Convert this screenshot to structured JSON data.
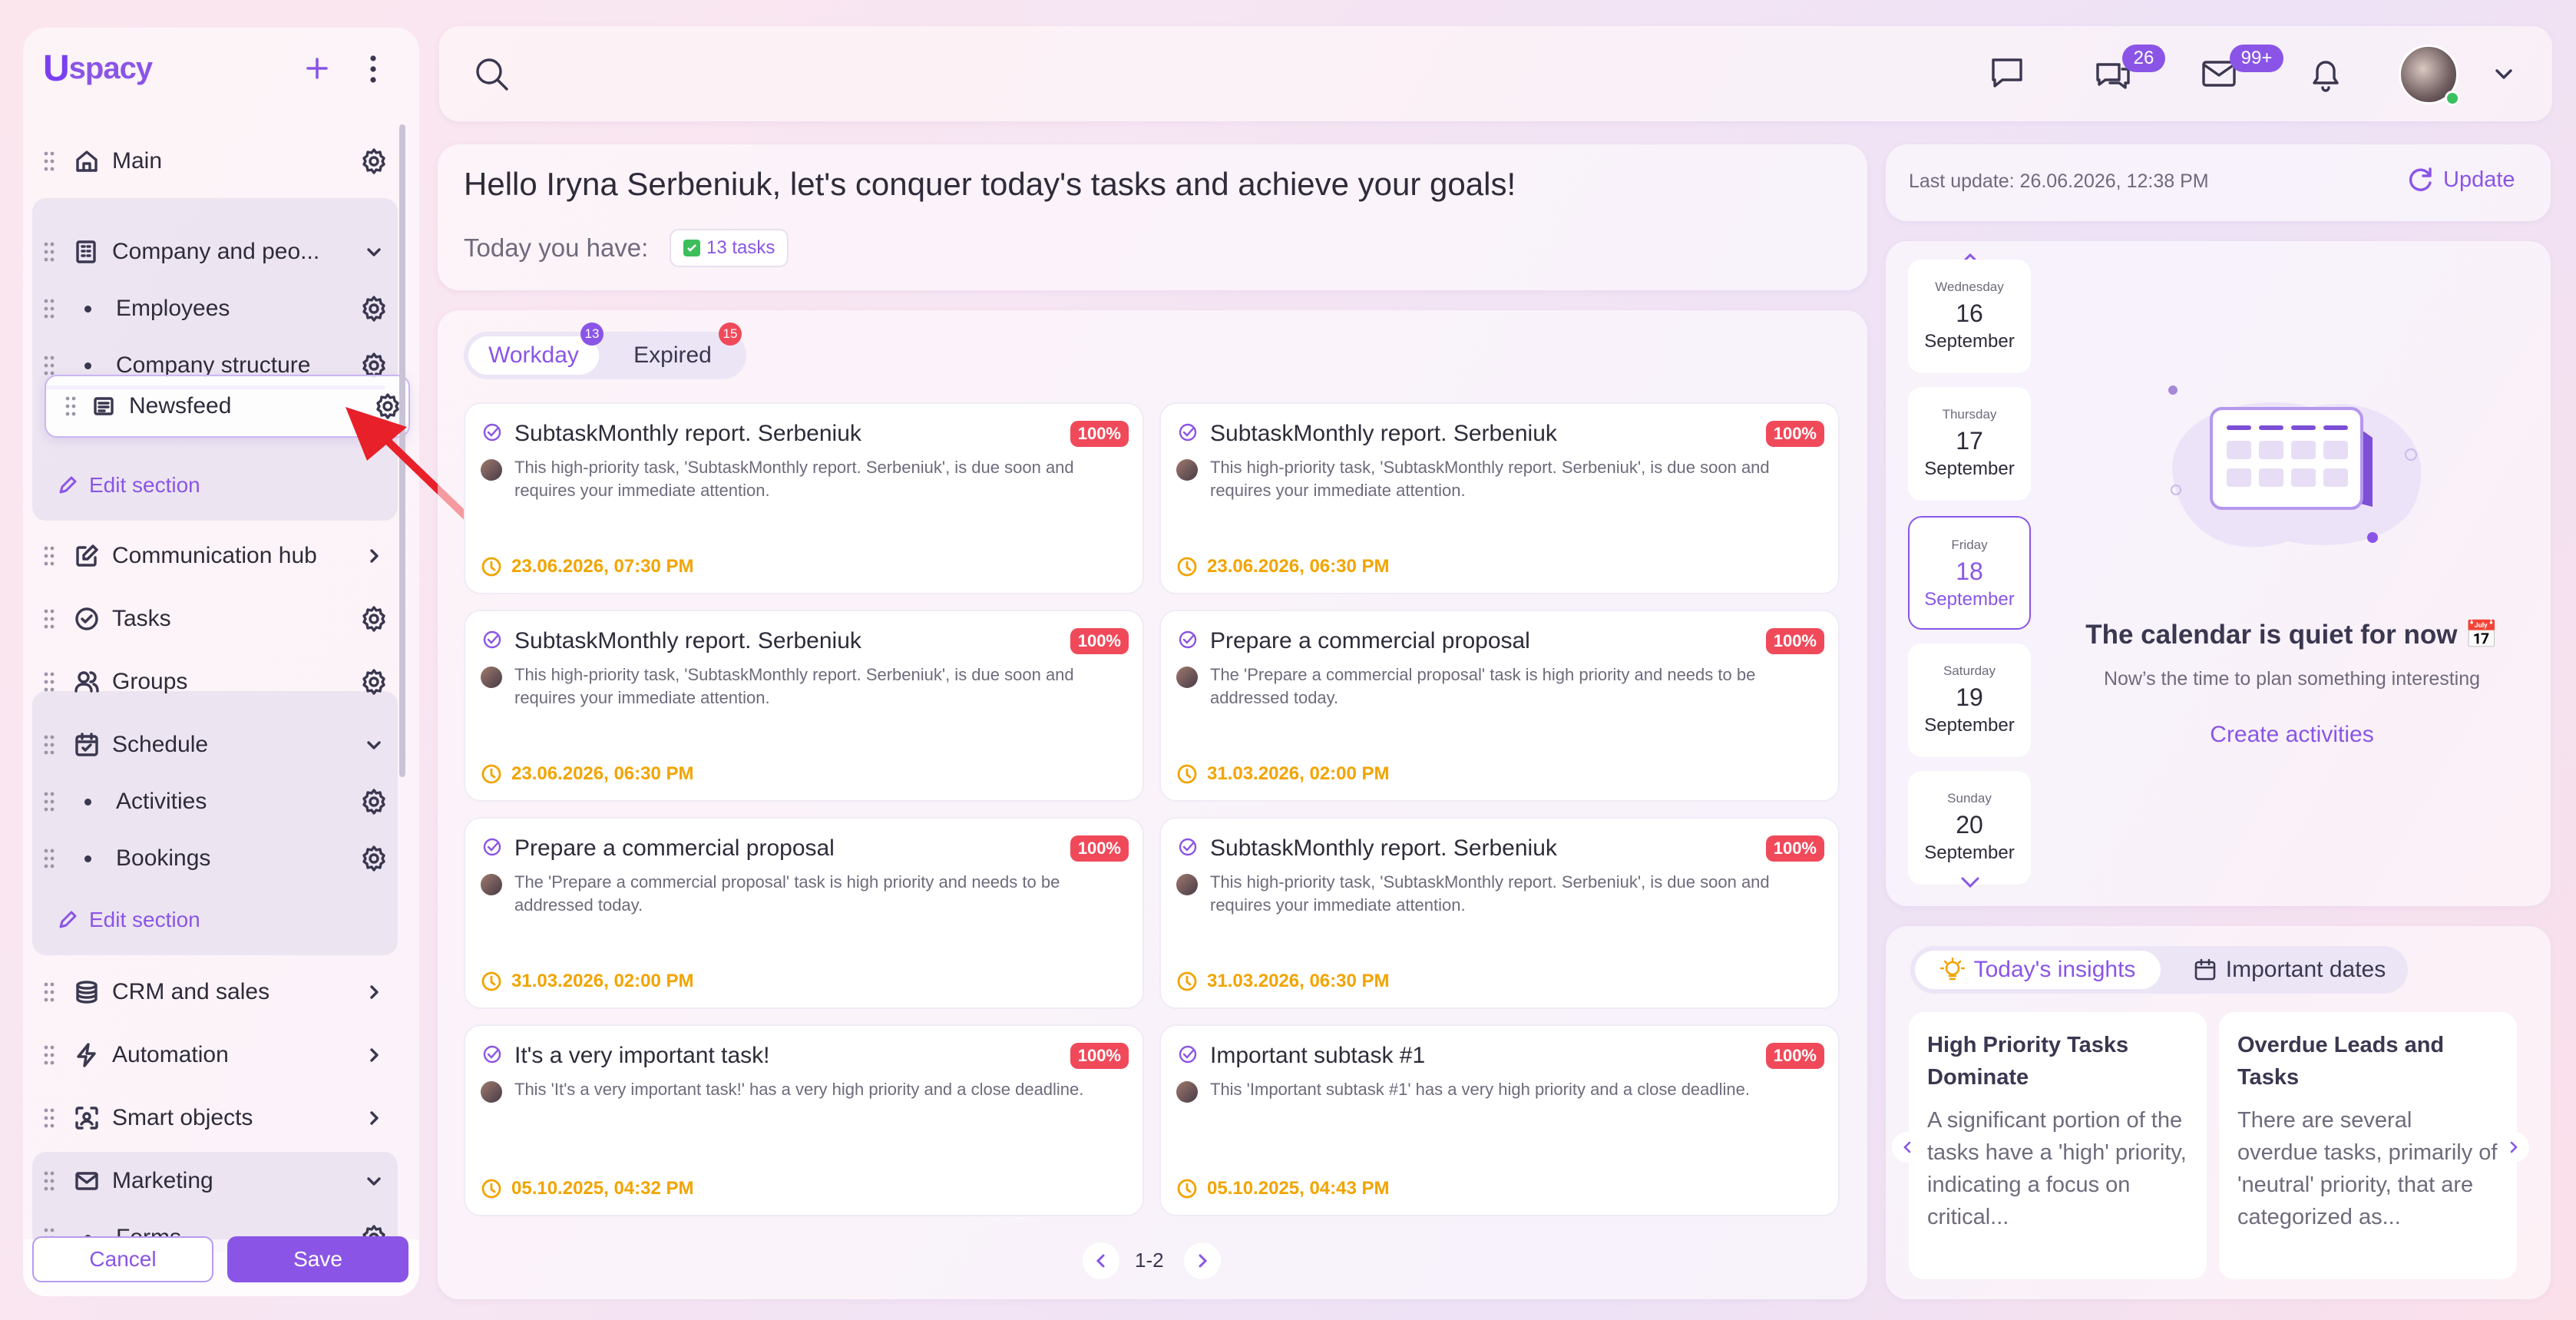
{
  "app": {
    "logo": "spacy",
    "logo_mark": "U"
  },
  "sidebar": {
    "items": [
      {
        "label": "Main"
      },
      {
        "label": "Company and peo..."
      },
      {
        "label": "Employees"
      },
      {
        "label": "Company structure"
      },
      {
        "label": "Newsfeed"
      },
      {
        "label": "Communication hub"
      },
      {
        "label": "Tasks"
      },
      {
        "label": "Groups"
      },
      {
        "label": "Schedule"
      },
      {
        "label": "Activities"
      },
      {
        "label": "Bookings"
      },
      {
        "label": "CRM and sales"
      },
      {
        "label": "Automation"
      },
      {
        "label": "Smart objects"
      },
      {
        "label": "Marketing"
      },
      {
        "label": "Forms"
      }
    ],
    "edit_section": "Edit section",
    "cancel": "Cancel",
    "save": "Save"
  },
  "header": {
    "chat_badge": "26",
    "mail_badge": "99+"
  },
  "greeting": {
    "text": "Hello Iryna Serbeniuk, let's conquer today's tasks and achieve your goals!",
    "today_label": "Today you have:",
    "tasks_chip": "13 tasks"
  },
  "tabs": [
    {
      "label": "Workday",
      "count": "13"
    },
    {
      "label": "Expired",
      "count": "15"
    }
  ],
  "tasks": [
    {
      "title": "SubtaskMonthly report. Serbeniuk",
      "badge": "100%",
      "desc": "This high-priority task, 'SubtaskMonthly report. Serbeniuk', is due soon and requires your immediate attention.",
      "date": "23.06.2026, 07:30 PM"
    },
    {
      "title": "SubtaskMonthly report. Serbeniuk",
      "badge": "100%",
      "desc": "This high-priority task, 'SubtaskMonthly report. Serbeniuk', is due soon and requires your immediate attention.",
      "date": "23.06.2026, 06:30 PM"
    },
    {
      "title": "SubtaskMonthly report. Serbeniuk",
      "badge": "100%",
      "desc": "This high-priority task, 'SubtaskMonthly report. Serbeniuk', is due soon and requires your immediate attention.",
      "date": "23.06.2026, 06:30 PM"
    },
    {
      "title": "Prepare a commercial proposal",
      "badge": "100%",
      "desc": "The 'Prepare a commercial proposal' task is high priority and needs to be addressed today.",
      "date": "31.03.2026, 02:00 PM"
    },
    {
      "title": "Prepare a commercial proposal",
      "badge": "100%",
      "desc": "The 'Prepare a commercial proposal' task is high priority and needs to be addressed today.",
      "date": "31.03.2026, 02:00 PM"
    },
    {
      "title": "SubtaskMonthly report. Serbeniuk",
      "badge": "100%",
      "desc": "This high-priority task, 'SubtaskMonthly report. Serbeniuk', is due soon and requires your immediate attention.",
      "date": "31.03.2026, 06:30 PM"
    },
    {
      "title": "It's a very important task!",
      "badge": "100%",
      "desc": "This 'It's a very important task!' has a very high priority and a close deadline.",
      "date": "05.10.2025, 04:32 PM"
    },
    {
      "title": "Important subtask #1",
      "badge": "100%",
      "desc": "This 'Important subtask #1' has a very high priority and a close deadline.",
      "date": "05.10.2025, 04:43 PM"
    }
  ],
  "pagination": {
    "label": "1-2"
  },
  "update_bar": {
    "last_update": "Last update: 26.06.2026, 12:38 PM",
    "button": "Update"
  },
  "calendar": {
    "days": [
      {
        "weekday": "Wednesday",
        "day": "16",
        "month": "September"
      },
      {
        "weekday": "Thursday",
        "day": "17",
        "month": "September"
      },
      {
        "weekday": "Friday",
        "day": "18",
        "month": "September"
      },
      {
        "weekday": "Saturday",
        "day": "19",
        "month": "September"
      },
      {
        "weekday": "Sunday",
        "day": "20",
        "month": "September"
      }
    ],
    "empty_title": "The calendar is quiet for now 📅",
    "empty_sub": "Now’s the time to plan something interesting",
    "create": "Create activities"
  },
  "insights": {
    "tabs": [
      "Today's insights",
      "Important dates"
    ],
    "cards": [
      {
        "title": "High Priority Tasks Dominate",
        "body": "A significant portion of the tasks have a 'high' priority, indicating a focus on critical..."
      },
      {
        "title": "Overdue Leads and Tasks",
        "body": "There are several overdue tasks, primarily of 'neutral' priority, that are categorized as..."
      }
    ]
  },
  "colors": {
    "accent": "#8a55e6",
    "badge_red": "#f04a5a",
    "date_orange": "#f2a400",
    "arrow": "#e8202a"
  }
}
